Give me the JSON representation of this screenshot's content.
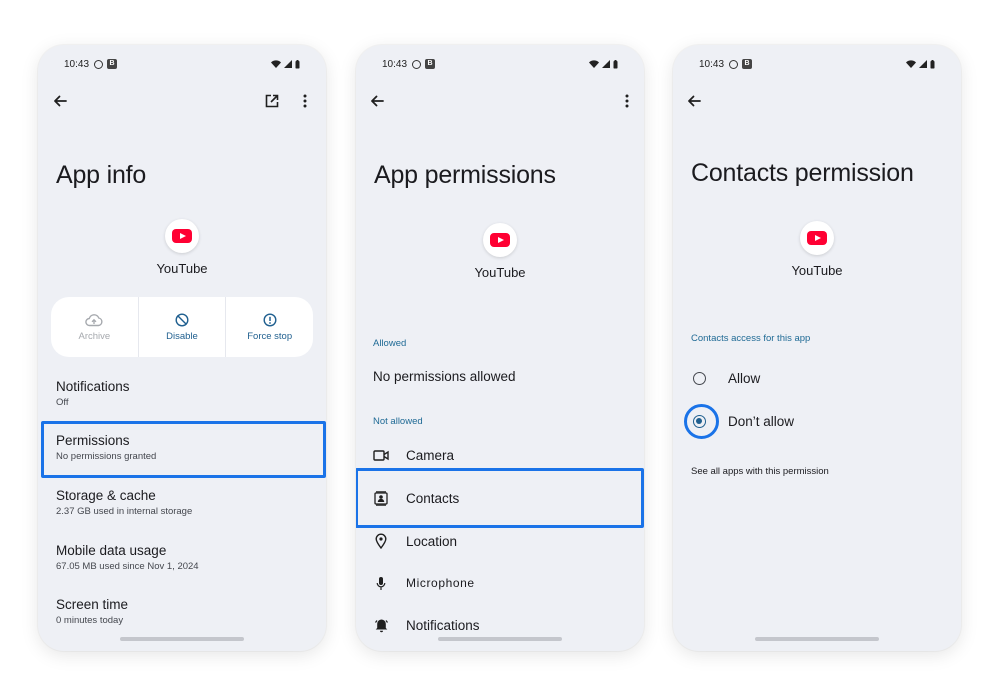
{
  "status_time": "10:43",
  "status_badge": "B",
  "screen1": {
    "title": "App info",
    "app_name": "YouTube",
    "actions": [
      {
        "label": "Archive",
        "icon": "cloud-archive-icon",
        "enabled": false
      },
      {
        "label": "Disable",
        "icon": "disable-icon",
        "enabled": true
      },
      {
        "label": "Force stop",
        "icon": "force-stop-icon",
        "enabled": true
      }
    ],
    "items": [
      {
        "title": "Notifications",
        "subtitle": "Off"
      },
      {
        "title": "Permissions",
        "subtitle": "No permissions granted"
      },
      {
        "title": "Storage & cache",
        "subtitle": "2.37 GB used in internal storage"
      },
      {
        "title": "Mobile data usage",
        "subtitle": "67.05 MB used since Nov 1, 2024"
      },
      {
        "title": "Screen time",
        "subtitle": "0 minutes today"
      }
    ]
  },
  "screen2": {
    "title": "App permissions",
    "app_name": "YouTube",
    "allowed_label": "Allowed",
    "allowed_empty": "No permissions allowed",
    "not_allowed_label": "Not allowed",
    "permissions": [
      {
        "label": "Camera",
        "icon": "camera-icon"
      },
      {
        "label": "Contacts",
        "icon": "contacts-icon"
      },
      {
        "label": "Location",
        "icon": "location-icon"
      },
      {
        "label": "Microphone",
        "icon": "microphone-icon"
      },
      {
        "label": "Notifications",
        "icon": "bell-icon"
      }
    ]
  },
  "screen3": {
    "title": "Contacts permission",
    "app_name": "YouTube",
    "section_label": "Contacts access for this app",
    "options": [
      {
        "label": "Allow",
        "selected": false
      },
      {
        "label": "Don’t allow",
        "selected": true
      }
    ],
    "see_all": "See all apps with this permission"
  },
  "colors": {
    "screen_bg": "#eef0f5",
    "highlight": "#1a73e8",
    "accent": "#1f5f8f",
    "youtube_red": "#ff0033"
  }
}
